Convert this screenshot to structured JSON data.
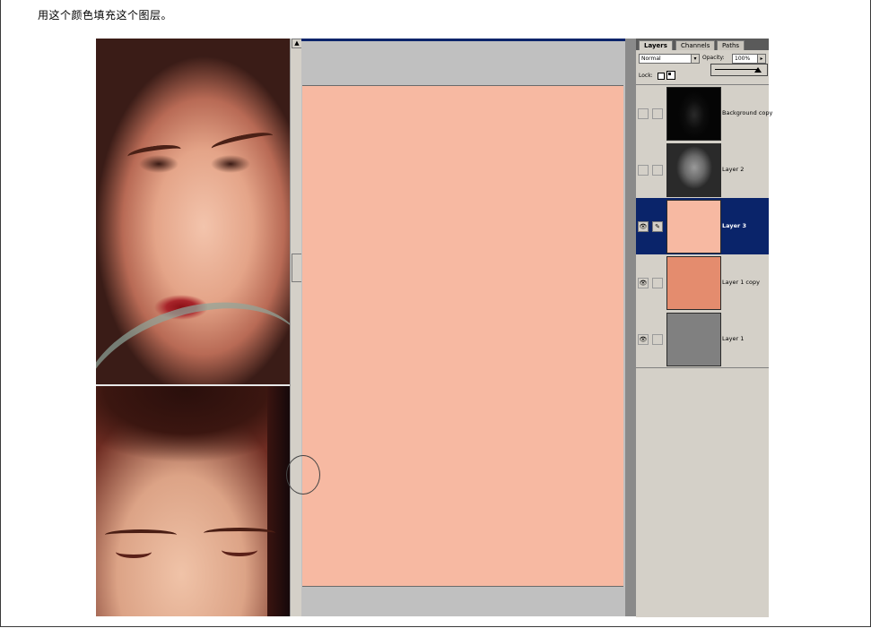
{
  "caption": "用这个颜色填充这个图层。",
  "photo_strip": {
    "scroll_up_glyph": "▲"
  },
  "canvas": {
    "fill_color": "#f7b9a2"
  },
  "layers_palette": {
    "tabs": [
      {
        "label": "Layers",
        "active": true
      },
      {
        "label": "Channels",
        "active": false
      },
      {
        "label": "Paths",
        "active": false
      }
    ],
    "blend_mode": "Normal",
    "blend_dropdown_glyph": "▾",
    "opacity_label": "Opacity:",
    "opacity_value": "100%",
    "opacity_arrow_glyph": "▸",
    "lock_label": "Lock:",
    "layers": [
      {
        "name": "Background copy",
        "thumbnail": "noise",
        "visible": false,
        "selected": false,
        "eye_glyph": "",
        "brush_glyph": ""
      },
      {
        "name": "Layer 2",
        "thumbnail": "face",
        "visible": false,
        "selected": false,
        "eye_glyph": "",
        "brush_glyph": ""
      },
      {
        "name": "Layer 3",
        "thumbnail": "swatch",
        "swatch": "#f7b9a2",
        "visible": true,
        "selected": true,
        "eye_glyph": "👁",
        "brush_glyph": "✎"
      },
      {
        "name": "Layer 1 copy",
        "thumbnail": "swatch",
        "swatch": "#e48c6e",
        "visible": true,
        "selected": false,
        "eye_glyph": "👁",
        "brush_glyph": ""
      },
      {
        "name": "Layer 1",
        "thumbnail": "swatch",
        "swatch": "#808080",
        "visible": true,
        "selected": false,
        "eye_glyph": "👁",
        "brush_glyph": ""
      }
    ]
  },
  "colors": {
    "selected_row": "#0a246a",
    "ui_gray": "#d4d0c8"
  }
}
